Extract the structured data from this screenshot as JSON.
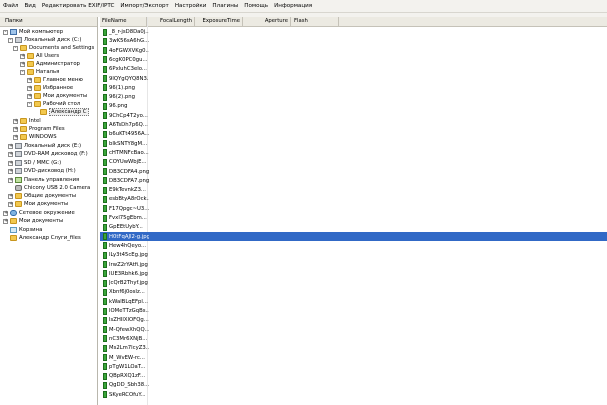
{
  "menu": [
    "Файл",
    "Вид",
    "Редактировать EXIF/IPTC",
    "Импорт/Экспорт",
    "Настройки",
    "Плагины",
    "Помощь",
    "Информация"
  ],
  "left_pane": {
    "header": "Папки",
    "tree": [
      {
        "label": "Мой компьютер",
        "icon": "computer-icon",
        "expander": "-"
      },
      {
        "label": "Локальный диск (C:)",
        "icon": "drive-icon",
        "expander": "-"
      },
      {
        "label": "Documents and Settings",
        "icon": "folder-icon",
        "expander": "-"
      },
      {
        "label": "All Users",
        "icon": "folder-icon",
        "expander": "+"
      },
      {
        "label": "Администратор",
        "icon": "folder-icon",
        "expander": "+"
      },
      {
        "label": "Наталья",
        "icon": "folder-icon",
        "expander": "-"
      },
      {
        "label": "Главное меню",
        "icon": "folder-icon",
        "expander": "+"
      },
      {
        "label": "Избранное",
        "icon": "folder-icon",
        "expander": "+"
      },
      {
        "label": "Мои документы",
        "icon": "folder-icon",
        "expander": "+"
      },
      {
        "label": "Рабочий стол",
        "icon": "folder-icon",
        "expander": "-"
      },
      {
        "label": "Александр С",
        "icon": "folder-icon",
        "expander": ""
      },
      {
        "label": "Intel",
        "icon": "folder-icon",
        "expander": "+"
      },
      {
        "label": "Program Files",
        "icon": "folder-icon",
        "expander": "+"
      },
      {
        "label": "WINDOWS",
        "icon": "folder-icon",
        "expander": "+"
      },
      {
        "label": "Локальный диск (E:)",
        "icon": "drive-icon",
        "expander": "+"
      },
      {
        "label": "DVD-RAM дисковод (F:)",
        "icon": "drive-icon",
        "expander": "+"
      },
      {
        "label": "SD / MMC (G:)",
        "icon": "drive-icon",
        "expander": "+"
      },
      {
        "label": "DVD-дисковод (H:)",
        "icon": "drive-icon",
        "expander": "+"
      },
      {
        "label": "Панель управления",
        "icon": "control-panel-icon",
        "expander": "+"
      },
      {
        "label": "Chicony USB 2.0 Camera",
        "icon": "camera-icon",
        "expander": ""
      },
      {
        "label": "Общие документы",
        "icon": "folder-icon",
        "expander": "+"
      },
      {
        "label": "Мои документы",
        "icon": "folder-icon",
        "expander": "+"
      },
      {
        "label": "Сетевое окружение",
        "icon": "network-icon",
        "expander": "+"
      },
      {
        "label": "Мои документы",
        "icon": "folder-icon",
        "expander": "+"
      },
      {
        "label": "Корзина",
        "icon": "recycle-bin-icon",
        "expander": ""
      },
      {
        "label": "Александр Слуги_files",
        "icon": "folder-icon",
        "expander": ""
      }
    ]
  },
  "grid": {
    "columns": [
      "FileName",
      "FocalLength",
      "ExposureTime",
      "Aperture",
      "Flash"
    ],
    "files": [
      "_8_r-jsD8Da0j...",
      "3wK56sA6hG...",
      "4oFGWXVKg0...",
      "6cgK0PC0gu...",
      "6PxluhC3eIo...",
      "9lQYgQYQ8N3...",
      "96(1).png",
      "96(2).png",
      "96.png",
      "9ChCp4T2yo...",
      "A6TsDh7p6Q...",
      "b6uKTt4956A...",
      "bIkSNTY8gM...",
      "cHTMNFcBao...",
      "COYUwWbjE...",
      "DB3CDFA4.png",
      "DB3CDFA7.png",
      "E9kTevnkZ3...",
      "esbBtyA8rOck...",
      "F17Qpgc~U3...",
      "Fvxl75gEbm...",
      "GpEEtUybY...",
      "H0tFqAJl2-g.jpg",
      "Hew4hQeyo...",
      "ILy3t45cEg.jpg",
      "IrwZ2rYAtfi.jpg",
      "IUE3Rbhk6.jpg",
      "JcQrB2Thyf.jpg",
      "Xbnf6j0osIz...",
      "kWalBLqEFpl...",
      "lOMeTTzGqBs...",
      "lsZHIlXlOFQg...",
      "M-QfewXhQQ...",
      "nC3Mr6XNjB...",
      "Ms2Lm7lcyZ3...",
      "M_WvEW-rc...",
      "pTgW1LOaT...",
      "QBpRXQ1zF...",
      "QgDD_Sbh38...",
      "SKyeRCOfuY..."
    ],
    "selected_index": 22
  }
}
